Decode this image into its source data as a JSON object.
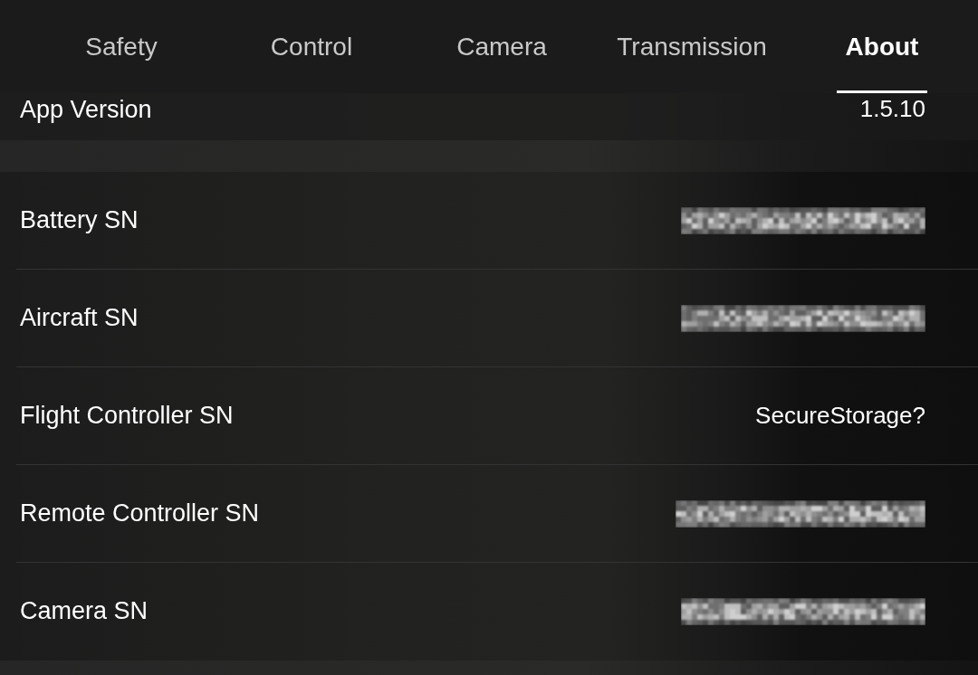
{
  "tabs": [
    {
      "label": "Safety",
      "selected": false
    },
    {
      "label": "Control",
      "selected": false
    },
    {
      "label": "Camera",
      "selected": false
    },
    {
      "label": "Transmission",
      "selected": false
    },
    {
      "label": "About",
      "selected": true
    }
  ],
  "app_version": {
    "label": "App Version",
    "value": "1.5.10"
  },
  "serial_numbers": [
    {
      "label": "Battery SN",
      "kind": "redacted"
    },
    {
      "label": "Aircraft SN",
      "kind": "redacted"
    },
    {
      "label": "Flight Controller SN",
      "kind": "text",
      "value": "SecureStorage?"
    },
    {
      "label": "Remote Controller SN",
      "kind": "redacted"
    },
    {
      "label": "Camera SN",
      "kind": "redacted"
    }
  ]
}
